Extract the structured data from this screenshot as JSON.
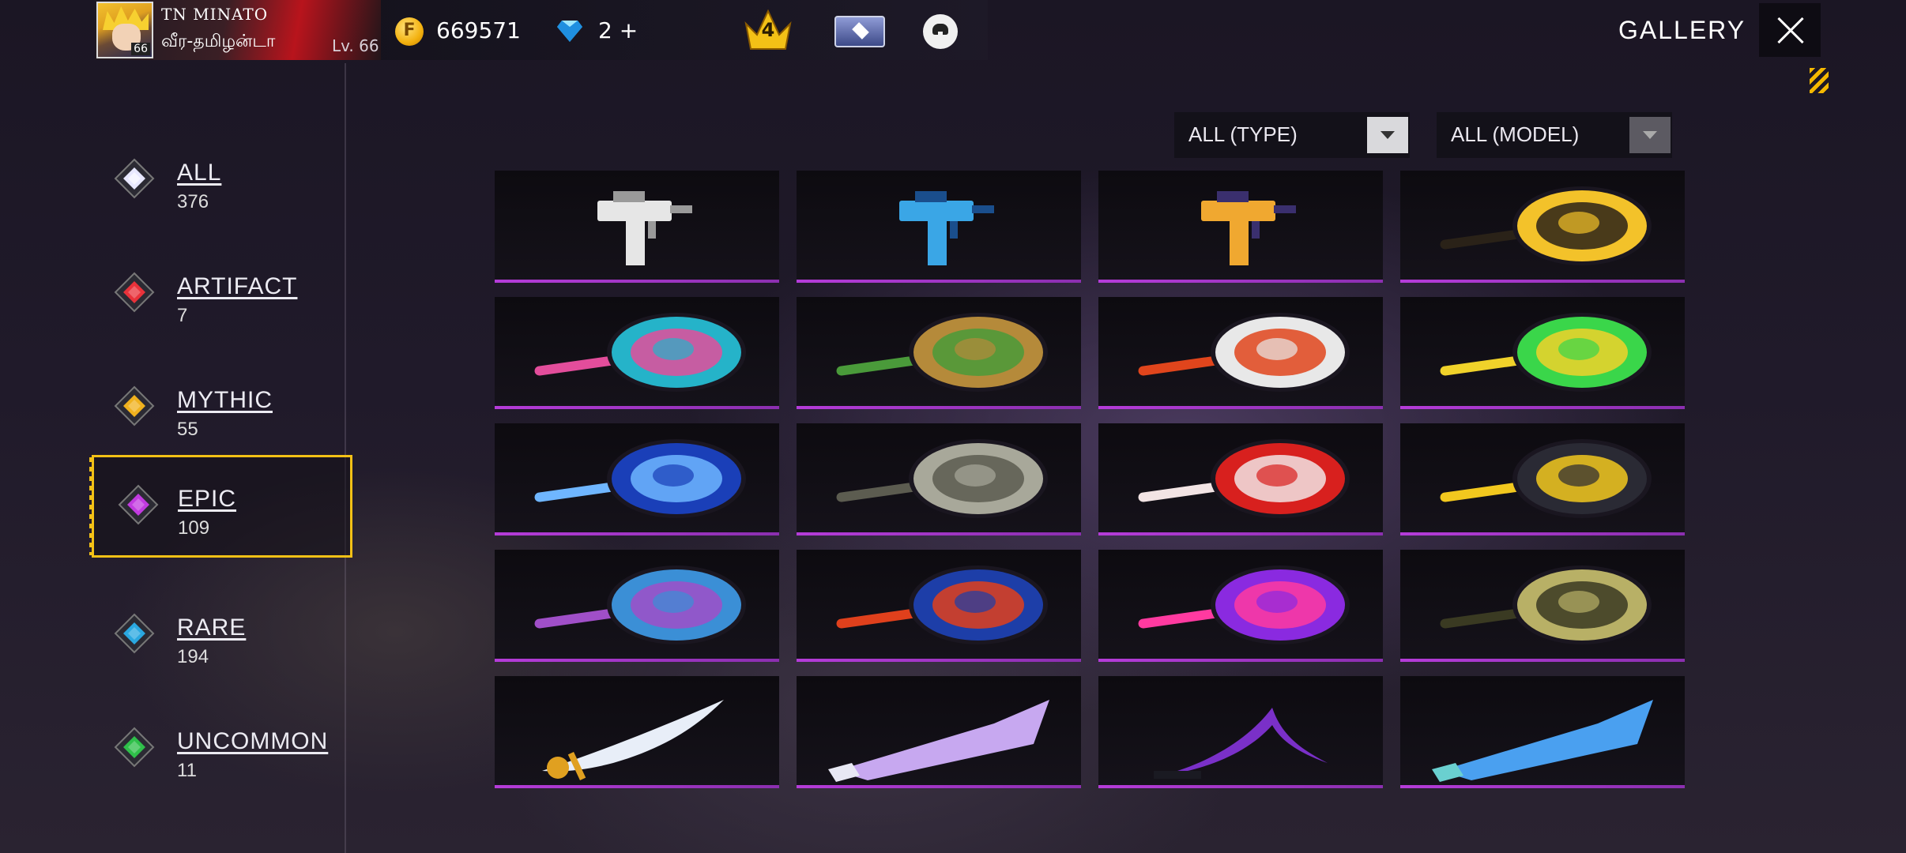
{
  "header": {
    "clan_tag": "TN  MINATO",
    "player_name": "வீர-தமிழன்டா",
    "player_level": "Lv. 66",
    "avatar_level": "66",
    "coins": "669571",
    "diamonds": "2 +",
    "rank_number": "4",
    "title": "GALLERY"
  },
  "sidebar": {
    "categories": [
      {
        "label": "ALL",
        "count": "376",
        "color": "#e8e8ff",
        "selected": false
      },
      {
        "label": "ARTIFACT",
        "count": "7",
        "color": "#e8323a",
        "selected": false
      },
      {
        "label": "MYTHIC",
        "count": "55",
        "color": "#f0b21e",
        "selected": false
      },
      {
        "label": "EPIC",
        "count": "109",
        "color": "#c23be0",
        "selected": true
      },
      {
        "label": "RARE",
        "count": "194",
        "color": "#2aa8e0",
        "selected": false
      },
      {
        "label": "UNCOMMON",
        "count": "11",
        "color": "#2fc04a",
        "selected": false
      }
    ]
  },
  "filters": {
    "type_label": "ALL (TYPE)",
    "model_label": "ALL (MODEL)"
  },
  "items": [
    {
      "kind": "gun",
      "colors": [
        "#e6e6e6",
        "#9a9a9a"
      ]
    },
    {
      "kind": "gun",
      "colors": [
        "#3aa6e6",
        "#1a4e8c"
      ]
    },
    {
      "kind": "gun",
      "colors": [
        "#f0a830",
        "#3a2f6e"
      ]
    },
    {
      "kind": "pan",
      "colors": [
        "#f3c22a",
        "#2a2218"
      ]
    },
    {
      "kind": "pan",
      "colors": [
        "#25b3c9",
        "#e34d9b"
      ]
    },
    {
      "kind": "pan",
      "colors": [
        "#b58a3a",
        "#4a9a3a"
      ]
    },
    {
      "kind": "pan",
      "colors": [
        "#e8e8e8",
        "#e0451c"
      ]
    },
    {
      "kind": "pan",
      "colors": [
        "#3ad64a",
        "#f0d22a"
      ]
    },
    {
      "kind": "pan",
      "colors": [
        "#1a3fb8",
        "#6fb6ff"
      ]
    },
    {
      "kind": "pan",
      "colors": [
        "#a8a89a",
        "#5c5c50"
      ]
    },
    {
      "kind": "pan",
      "colors": [
        "#d8201e",
        "#f2e4e4"
      ]
    },
    {
      "kind": "pan",
      "colors": [
        "#2a2a34",
        "#f2c81e"
      ]
    },
    {
      "kind": "pan",
      "colors": [
        "#3b8fd6",
        "#a04fc8"
      ]
    },
    {
      "kind": "pan",
      "colors": [
        "#1d3ea8",
        "#e0401c"
      ]
    },
    {
      "kind": "pan",
      "colors": [
        "#8a2ae0",
        "#ff3aa0"
      ]
    },
    {
      "kind": "pan",
      "colors": [
        "#b8b066",
        "#3a3a22"
      ]
    },
    {
      "kind": "blade",
      "colors": [
        "#e8eef8",
        "#e0a020"
      ]
    },
    {
      "kind": "cleaver",
      "colors": [
        "#c7a8f0",
        "#e8e8f4"
      ]
    },
    {
      "kind": "scythe",
      "colors": [
        "#7a30c8",
        "#1a1a22"
      ]
    },
    {
      "kind": "cleaver",
      "colors": [
        "#4aa0f0",
        "#6ad0d0"
      ]
    }
  ]
}
